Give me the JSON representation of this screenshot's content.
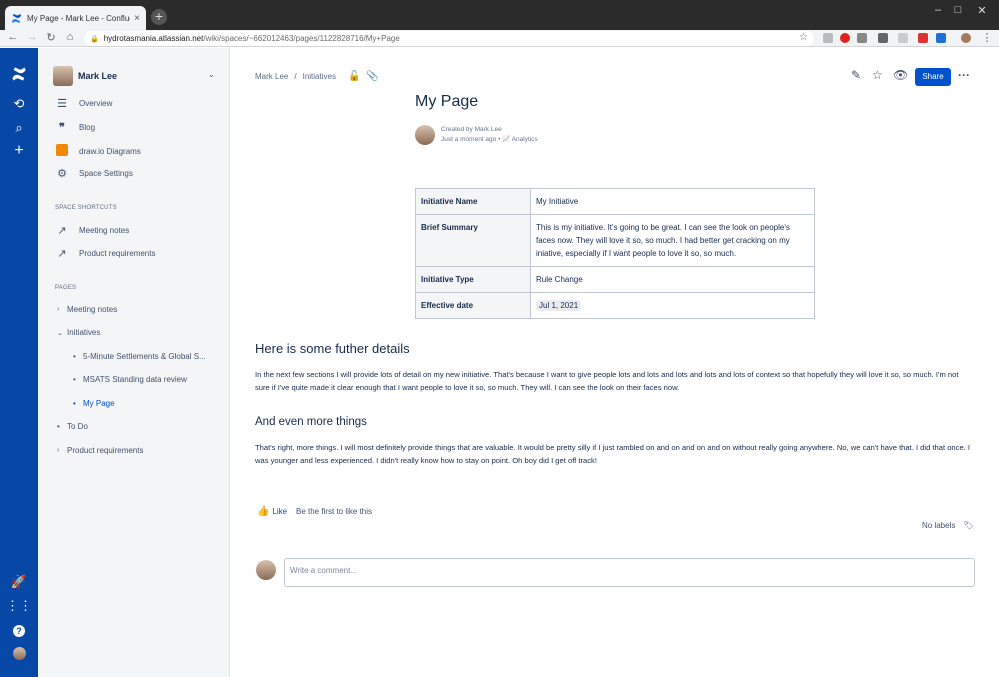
{
  "browser": {
    "tab_title": "My Page - Mark Lee - Confluence",
    "url_domain": "hydrotasmania.atlassian.net",
    "url_path": "/wiki/spaces/~662012463/pages/1122828716/My+Page"
  },
  "sidebar": {
    "space_name": "Mark Lee",
    "nav": [
      {
        "label": "Overview",
        "icon": "overview-icon"
      },
      {
        "label": "Blog",
        "icon": "quote-icon"
      },
      {
        "label": "draw.io Diagrams",
        "icon": "drawio-icon"
      },
      {
        "label": "Space Settings",
        "icon": "gear-icon"
      }
    ],
    "shortcuts_label": "SPACE SHORTCUTS",
    "shortcuts": [
      "Meeting notes",
      "Product requirements"
    ],
    "pages_label": "PAGES",
    "tree": [
      {
        "label": "Meeting notes"
      },
      {
        "label": "Initiatives"
      },
      {
        "label": "5-Minute Settlements & Global S..."
      },
      {
        "label": "MSATS Standing data review"
      },
      {
        "label": "My Page"
      },
      {
        "label": "To Do"
      },
      {
        "label": "Product requirements"
      }
    ]
  },
  "breadcrumb": [
    "Mark Lee",
    "/",
    "Initiatives"
  ],
  "header": {
    "share_label": "Share"
  },
  "page": {
    "title": "My Page",
    "created_by": "Created by Mark Lee",
    "modified": "Just a moment ago",
    "analytics": "Analytics"
  },
  "table": [
    {
      "key": "Initiative Name",
      "value": "My Initiative"
    },
    {
      "key": "Brief Summary",
      "value": "This is my initiative. It's going to be great. I can see the look on people's faces now. They will love it so, so much. I had better get cracking on my iniative, especially if I want people to love it so, so much."
    },
    {
      "key": "Initiative Type",
      "value": "Rule Change"
    },
    {
      "key": "Effective date",
      "value": "Jul 1, 2021"
    }
  ],
  "sections": [
    {
      "heading": "Here is some futher details",
      "body": "In the next few sections I will provide lots of detail on my new initiative. That's because I want to give people lots and lots and lots and lots and lots of context so that hopefully they will love it so, so much. I'm not sure if I've quite made it clear enough that I want people to love it so, so much. They will. I can see the look on their faces now."
    },
    {
      "heading": "And even more things",
      "body": "That's right, more things. I will most definitely provide things that are valuable. It would be pretty silly if I just rambled on and on and on and on without really going anywhere. No, we can't have that. I did that once. I was younger and less experienced. I didn't really know how to stay on point. Oh boy did I get off track!"
    }
  ],
  "footer": {
    "like_label": "Like",
    "like_info": "Be the first to like this",
    "labels_label": "No labels",
    "comment_placeholder": "Write a comment..."
  }
}
